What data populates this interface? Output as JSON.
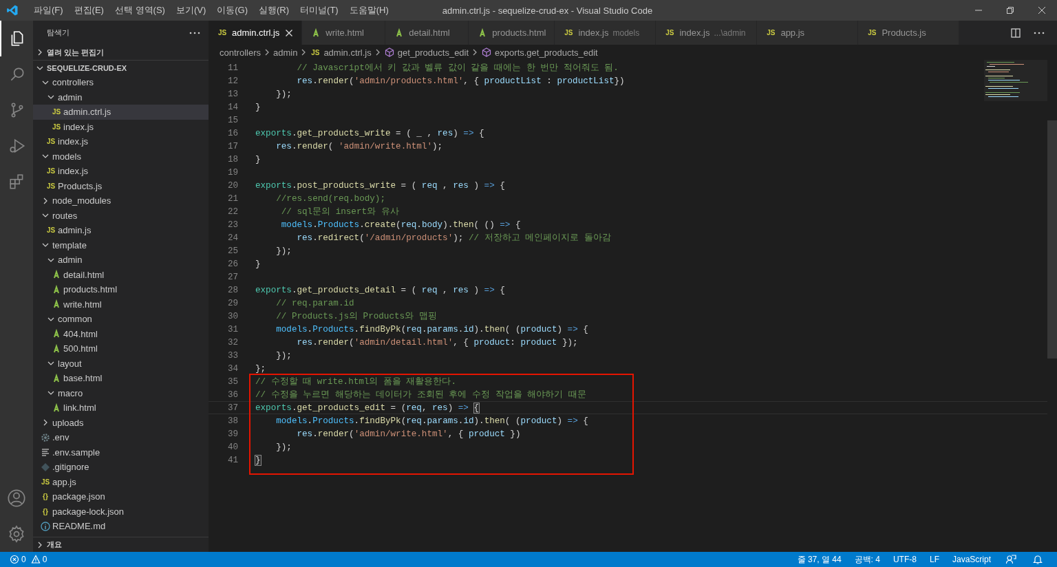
{
  "window": {
    "title": "admin.ctrl.js - sequelize-crud-ex - Visual Studio Code"
  },
  "menu": [
    "파일(F)",
    "편집(E)",
    "선택 영역(S)",
    "보기(V)",
    "이동(G)",
    "실행(R)",
    "터미널(T)",
    "도움말(H)"
  ],
  "activity_bar": [
    {
      "kind": "files",
      "selected": true
    },
    {
      "kind": "search",
      "selected": false
    },
    {
      "kind": "source-control",
      "selected": false
    },
    {
      "kind": "run",
      "selected": false
    },
    {
      "kind": "extensions",
      "selected": false
    }
  ],
  "sidebar": {
    "title": "탐색기",
    "open_editors": {
      "label": "열려 있는 편집기",
      "expanded": false
    },
    "project": {
      "label": "SEQUELIZE-CRUD-EX",
      "expanded": true
    },
    "tree": [
      {
        "label": "controllers",
        "kind": "folder",
        "expanded": true,
        "selected": false,
        "children": [
          {
            "label": "admin",
            "kind": "folder",
            "expanded": true,
            "selected": false,
            "children": [
              {
                "label": "admin.ctrl.js",
                "kind": "js",
                "icon": "JS",
                "selected": true
              },
              {
                "label": "index.js",
                "kind": "js",
                "icon": "JS",
                "selected": false
              }
            ]
          },
          {
            "label": "index.js",
            "kind": "js",
            "icon": "JS",
            "selected": false
          }
        ]
      },
      {
        "label": "models",
        "kind": "folder",
        "expanded": true,
        "selected": false,
        "children": [
          {
            "label": "index.js",
            "kind": "js",
            "icon": "JS",
            "selected": false
          },
          {
            "label": "Products.js",
            "kind": "js",
            "icon": "JS",
            "selected": false
          }
        ]
      },
      {
        "label": "node_modules",
        "kind": "folder",
        "expanded": false,
        "selected": false
      },
      {
        "label": "routes",
        "kind": "folder",
        "expanded": true,
        "selected": false,
        "children": [
          {
            "label": "admin.js",
            "kind": "js",
            "icon": "JS",
            "selected": false
          }
        ]
      },
      {
        "label": "template",
        "kind": "folder",
        "expanded": true,
        "selected": false,
        "children": [
          {
            "label": "admin",
            "kind": "folder",
            "expanded": true,
            "selected": false,
            "children": [
              {
                "label": "detail.html",
                "kind": "html",
                "selected": false
              },
              {
                "label": "products.html",
                "kind": "html",
                "selected": false
              },
              {
                "label": "write.html",
                "kind": "html",
                "selected": false
              }
            ]
          },
          {
            "label": "common",
            "kind": "folder",
            "expanded": true,
            "selected": false,
            "children": [
              {
                "label": "404.html",
                "kind": "html",
                "selected": false
              },
              {
                "label": "500.html",
                "kind": "html",
                "selected": false
              }
            ]
          },
          {
            "label": "layout",
            "kind": "folder",
            "expanded": true,
            "selected": false,
            "children": [
              {
                "label": "base.html",
                "kind": "html",
                "selected": false
              }
            ]
          },
          {
            "label": "macro",
            "kind": "folder",
            "expanded": true,
            "selected": false,
            "children": [
              {
                "label": "link.html",
                "kind": "html",
                "selected": false
              }
            ]
          }
        ]
      },
      {
        "label": "uploads",
        "kind": "folder",
        "expanded": false,
        "selected": false
      },
      {
        "label": ".env",
        "kind": "settings",
        "selected": false
      },
      {
        "label": ".env.sample",
        "kind": "text",
        "selected": false
      },
      {
        "label": ".gitignore",
        "kind": "git",
        "selected": false
      },
      {
        "label": "app.js",
        "kind": "js",
        "icon": "JS",
        "selected": false
      },
      {
        "label": "package.json",
        "kind": "json",
        "icon": "{}",
        "selected": false
      },
      {
        "label": "package-lock.json",
        "kind": "json",
        "icon": "{}",
        "selected": false
      },
      {
        "label": "README.md",
        "kind": "info",
        "selected": false
      }
    ],
    "outline": {
      "label": "개요",
      "expanded": false
    }
  },
  "tabs": [
    {
      "label": "admin.ctrl.js",
      "kind": "js",
      "icon": "JS",
      "selected": true
    },
    {
      "label": "write.html",
      "kind": "html",
      "selected": false
    },
    {
      "label": "detail.html",
      "kind": "html",
      "selected": false
    },
    {
      "label": "products.html",
      "kind": "html",
      "selected": false
    },
    {
      "label": "index.js",
      "detail": "models",
      "kind": "js",
      "icon": "JS",
      "selected": false
    },
    {
      "label": "index.js",
      "detail": "...\\admin",
      "kind": "js",
      "icon": "JS",
      "selected": false
    },
    {
      "label": "app.js",
      "kind": "js",
      "icon": "JS",
      "selected": false
    },
    {
      "label": "Products.js",
      "kind": "js",
      "icon": "JS",
      "selected": false
    }
  ],
  "breadcrumbs": [
    {
      "label": "controllers",
      "kind": "folder"
    },
    {
      "label": "admin",
      "kind": "folder"
    },
    {
      "label": "admin.ctrl.js",
      "kind": "js",
      "icon": "JS"
    },
    {
      "label": "get_products_edit",
      "kind": "symbol"
    },
    {
      "label": "exports.get_products_edit",
      "kind": "symbol"
    }
  ],
  "editor": {
    "lines": [
      {
        "n": "11",
        "current": false,
        "tokens": [
          {
            "t": "        // Javascript에서 키 값과 벨류 값이 같을 때에는 한 번만 적어줘도 됨.",
            "kind": "cm"
          }
        ]
      },
      {
        "n": "12",
        "current": false,
        "tokens": [
          {
            "t": "        res",
            "kind": "var"
          },
          {
            "t": ".",
            "kind": "p"
          },
          {
            "t": "render",
            "kind": "fn"
          },
          {
            "t": "(",
            "kind": "p"
          },
          {
            "t": "'admin/products.html'",
            "kind": "str"
          },
          {
            "t": ", { ",
            "kind": "p"
          },
          {
            "t": "productList",
            "kind": "var"
          },
          {
            "t": " : ",
            "kind": "p"
          },
          {
            "t": "productList",
            "kind": "var"
          },
          {
            "t": "})",
            "kind": "p"
          }
        ]
      },
      {
        "n": "13",
        "current": false,
        "tokens": [
          {
            "t": "    });",
            "kind": "p"
          }
        ]
      },
      {
        "n": "14",
        "current": false,
        "tokens": [
          {
            "t": "}",
            "kind": "p"
          }
        ]
      },
      {
        "n": "15",
        "current": false
      },
      {
        "n": "16",
        "current": false,
        "tokens": [
          {
            "t": "exports",
            "kind": "obj"
          },
          {
            "t": ".",
            "kind": "p"
          },
          {
            "t": "get_products_write",
            "kind": "fn"
          },
          {
            "t": " = ( _ , ",
            "kind": "p"
          },
          {
            "t": "res",
            "kind": "var"
          },
          {
            "t": ") ",
            "kind": "p"
          },
          {
            "t": "=>",
            "kind": "op"
          },
          {
            "t": " {",
            "kind": "p"
          }
        ]
      },
      {
        "n": "17",
        "current": false,
        "tokens": [
          {
            "t": "    res",
            "kind": "var"
          },
          {
            "t": ".",
            "kind": "p"
          },
          {
            "t": "render",
            "kind": "fn"
          },
          {
            "t": "( ",
            "kind": "p"
          },
          {
            "t": "'admin/write.html'",
            "kind": "str"
          },
          {
            "t": ");",
            "kind": "p"
          }
        ]
      },
      {
        "n": "18",
        "current": false,
        "tokens": [
          {
            "t": "}",
            "kind": "p"
          }
        ]
      },
      {
        "n": "19",
        "current": false
      },
      {
        "n": "20",
        "current": false,
        "tokens": [
          {
            "t": "exports",
            "kind": "obj"
          },
          {
            "t": ".",
            "kind": "p"
          },
          {
            "t": "post_products_write",
            "kind": "fn"
          },
          {
            "t": " = ( ",
            "kind": "p"
          },
          {
            "t": "req",
            "kind": "var"
          },
          {
            "t": " , ",
            "kind": "p"
          },
          {
            "t": "res",
            "kind": "var"
          },
          {
            "t": " ) ",
            "kind": "p"
          },
          {
            "t": "=>",
            "kind": "op"
          },
          {
            "t": " {",
            "kind": "p"
          }
        ]
      },
      {
        "n": "21",
        "current": false,
        "tokens": [
          {
            "t": "    //res.send(req.body);",
            "kind": "cm"
          }
        ]
      },
      {
        "n": "22",
        "current": false,
        "tokens": [
          {
            "t": "     // sql문의 insert와 유사",
            "kind": "cm"
          }
        ]
      },
      {
        "n": "23",
        "current": false,
        "tokens": [
          {
            "t": "     models",
            "kind": "mod"
          },
          {
            "t": ".",
            "kind": "p"
          },
          {
            "t": "Products",
            "kind": "mod"
          },
          {
            "t": ".",
            "kind": "p"
          },
          {
            "t": "create",
            "kind": "fn"
          },
          {
            "t": "(",
            "kind": "p"
          },
          {
            "t": "req",
            "kind": "var"
          },
          {
            "t": ".",
            "kind": "p"
          },
          {
            "t": "body",
            "kind": "var"
          },
          {
            "t": ").",
            "kind": "p"
          },
          {
            "t": "then",
            "kind": "fn"
          },
          {
            "t": "( () ",
            "kind": "p"
          },
          {
            "t": "=>",
            "kind": "op"
          },
          {
            "t": " {",
            "kind": "p"
          }
        ]
      },
      {
        "n": "24",
        "current": false,
        "tokens": [
          {
            "t": "        res",
            "kind": "var"
          },
          {
            "t": ".",
            "kind": "p"
          },
          {
            "t": "redirect",
            "kind": "fn"
          },
          {
            "t": "(",
            "kind": "p"
          },
          {
            "t": "'/admin/products'",
            "kind": "str"
          },
          {
            "t": "); ",
            "kind": "p"
          },
          {
            "t": "// 저장하고 메인페이지로 돌아감",
            "kind": "cm"
          }
        ]
      },
      {
        "n": "25",
        "current": false,
        "tokens": [
          {
            "t": "    });",
            "kind": "p"
          }
        ]
      },
      {
        "n": "26",
        "current": false,
        "tokens": [
          {
            "t": "}",
            "kind": "p"
          }
        ]
      },
      {
        "n": "27",
        "current": false
      },
      {
        "n": "28",
        "current": false,
        "tokens": [
          {
            "t": "exports",
            "kind": "obj"
          },
          {
            "t": ".",
            "kind": "p"
          },
          {
            "t": "get_products_detail",
            "kind": "fn"
          },
          {
            "t": " = ( ",
            "kind": "p"
          },
          {
            "t": "req",
            "kind": "var"
          },
          {
            "t": " , ",
            "kind": "p"
          },
          {
            "t": "res",
            "kind": "var"
          },
          {
            "t": " ) ",
            "kind": "p"
          },
          {
            "t": "=>",
            "kind": "op"
          },
          {
            "t": " {",
            "kind": "p"
          }
        ]
      },
      {
        "n": "29",
        "current": false,
        "tokens": [
          {
            "t": "    // req.param.id",
            "kind": "cm"
          }
        ]
      },
      {
        "n": "30",
        "current": false,
        "tokens": [
          {
            "t": "    // Products.js의 Products와 맵핑",
            "kind": "cm"
          }
        ]
      },
      {
        "n": "31",
        "current": false,
        "tokens": [
          {
            "t": "    models",
            "kind": "mod"
          },
          {
            "t": ".",
            "kind": "p"
          },
          {
            "t": "Products",
            "kind": "mod"
          },
          {
            "t": ".",
            "kind": "p"
          },
          {
            "t": "findByPk",
            "kind": "fn"
          },
          {
            "t": "(",
            "kind": "p"
          },
          {
            "t": "req",
            "kind": "var"
          },
          {
            "t": ".",
            "kind": "p"
          },
          {
            "t": "params",
            "kind": "var"
          },
          {
            "t": ".",
            "kind": "p"
          },
          {
            "t": "id",
            "kind": "var"
          },
          {
            "t": ").",
            "kind": "p"
          },
          {
            "t": "then",
            "kind": "fn"
          },
          {
            "t": "( (",
            "kind": "p"
          },
          {
            "t": "product",
            "kind": "var"
          },
          {
            "t": ") ",
            "kind": "p"
          },
          {
            "t": "=>",
            "kind": "op"
          },
          {
            "t": " {",
            "kind": "p"
          }
        ]
      },
      {
        "n": "32",
        "current": false,
        "tokens": [
          {
            "t": "        res",
            "kind": "var"
          },
          {
            "t": ".",
            "kind": "p"
          },
          {
            "t": "render",
            "kind": "fn"
          },
          {
            "t": "(",
            "kind": "p"
          },
          {
            "t": "'admin/detail.html'",
            "kind": "str"
          },
          {
            "t": ", { ",
            "kind": "p"
          },
          {
            "t": "product",
            "kind": "var"
          },
          {
            "t": ": ",
            "kind": "p"
          },
          {
            "t": "product",
            "kind": "var"
          },
          {
            "t": " });",
            "kind": "p"
          }
        ]
      },
      {
        "n": "33",
        "current": false,
        "tokens": [
          {
            "t": "    });",
            "kind": "p"
          }
        ]
      },
      {
        "n": "34",
        "current": false,
        "tokens": [
          {
            "t": "};",
            "kind": "p"
          }
        ]
      }
    ],
    "boxed_lines": [
      {
        "n": "35",
        "current": false,
        "tokens": [
          {
            "t": "// 수정할 때 write.html의 폼을 재활용한다.",
            "kind": "cm"
          }
        ]
      },
      {
        "n": "36",
        "current": false,
        "tokens": [
          {
            "t": "// 수정을 누르면 해당하는 데이터가 조회된 후에 수정 작업을 해야하기 때문",
            "kind": "cm"
          }
        ]
      },
      {
        "n": "37",
        "current": true,
        "tokens": [
          {
            "t": "exports",
            "kind": "obj"
          },
          {
            "t": ".",
            "kind": "p"
          },
          {
            "t": "get_products_edit",
            "kind": "fn"
          },
          {
            "t": " = (",
            "kind": "p"
          },
          {
            "t": "req",
            "kind": "var"
          },
          {
            "t": ", ",
            "kind": "p"
          },
          {
            "t": "res",
            "kind": "var"
          },
          {
            "t": ") ",
            "kind": "p"
          },
          {
            "t": "=> ",
            "kind": "op"
          },
          {
            "t": "{",
            "kind": "match"
          }
        ]
      },
      {
        "n": "38",
        "current": false,
        "tokens": [
          {
            "t": "    models",
            "kind": "mod"
          },
          {
            "t": ".",
            "kind": "p"
          },
          {
            "t": "Products",
            "kind": "mod"
          },
          {
            "t": ".",
            "kind": "p"
          },
          {
            "t": "findByPk",
            "kind": "fn"
          },
          {
            "t": "(",
            "kind": "p"
          },
          {
            "t": "req",
            "kind": "var"
          },
          {
            "t": ".",
            "kind": "p"
          },
          {
            "t": "params",
            "kind": "var"
          },
          {
            "t": ".",
            "kind": "p"
          },
          {
            "t": "id",
            "kind": "var"
          },
          {
            "t": ").",
            "kind": "p"
          },
          {
            "t": "then",
            "kind": "fn"
          },
          {
            "t": "( (",
            "kind": "p"
          },
          {
            "t": "product",
            "kind": "var"
          },
          {
            "t": ") ",
            "kind": "p"
          },
          {
            "t": "=>",
            "kind": "op"
          },
          {
            "t": " {",
            "kind": "p"
          }
        ]
      },
      {
        "n": "39",
        "current": false,
        "tokens": [
          {
            "t": "        res",
            "kind": "var"
          },
          {
            "t": ".",
            "kind": "p"
          },
          {
            "t": "render",
            "kind": "fn"
          },
          {
            "t": "(",
            "kind": "p"
          },
          {
            "t": "'admin/write.html'",
            "kind": "str"
          },
          {
            "t": ", { ",
            "kind": "p"
          },
          {
            "t": "product",
            "kind": "var"
          },
          {
            "t": " })",
            "kind": "p"
          }
        ]
      },
      {
        "n": "40",
        "current": false,
        "tokens": [
          {
            "t": "    });",
            "kind": "p"
          }
        ]
      },
      {
        "n": "41",
        "current": false,
        "tokens": [
          {
            "t": "}",
            "kind": "match"
          }
        ]
      }
    ]
  },
  "status_bar": {
    "errors": "0",
    "warnings": "0",
    "right": [
      "줄 37, 열 44",
      "공백: 4",
      "UTF-8",
      "LF",
      "JavaScript"
    ]
  }
}
